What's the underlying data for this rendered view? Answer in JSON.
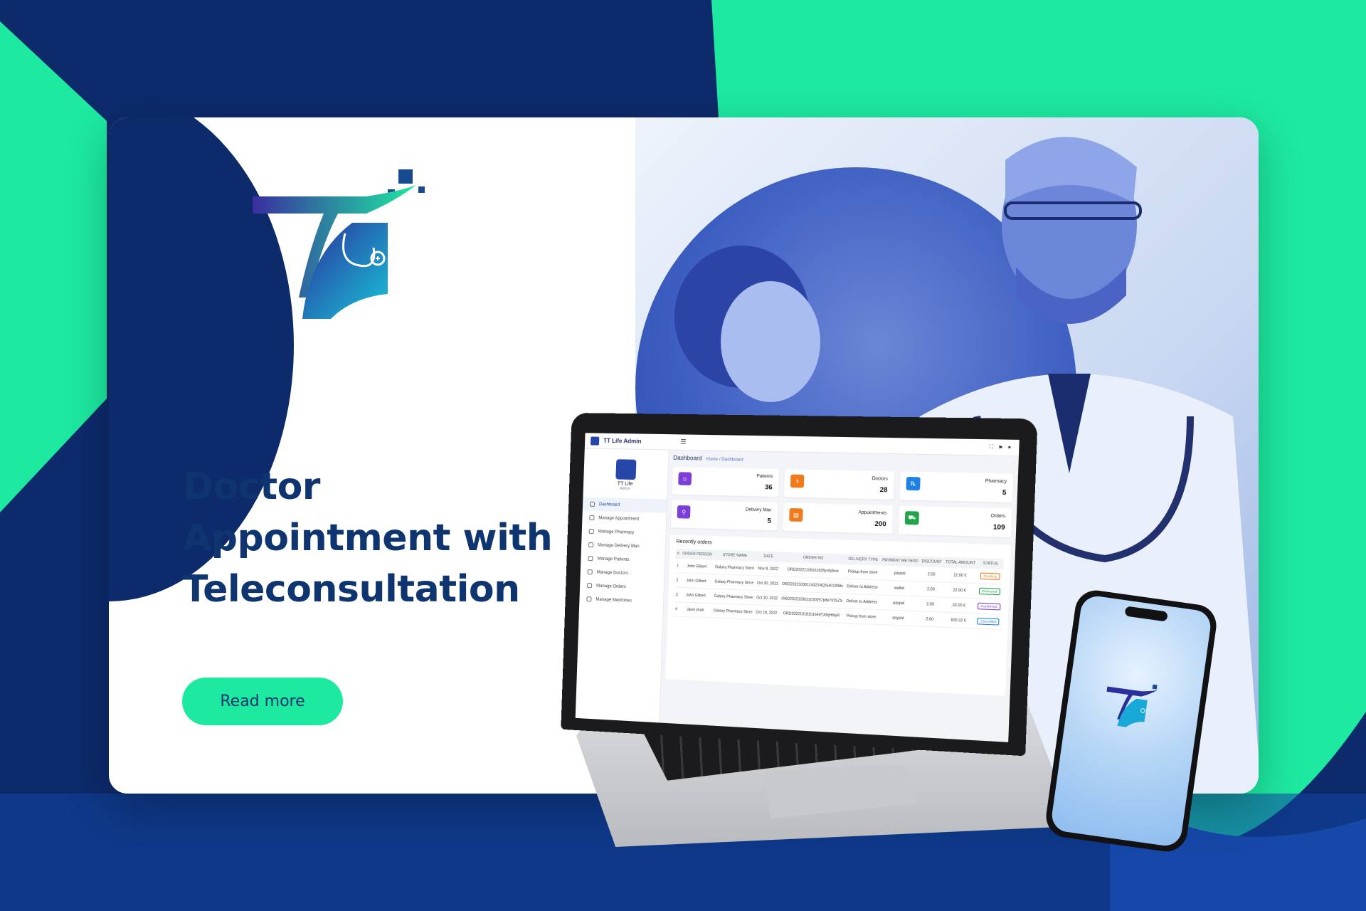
{
  "headline": {
    "line1": "Doctor",
    "line2": "Appointment with",
    "line3": "Teleconsultation"
  },
  "cta": {
    "label": "Read more"
  },
  "colors": {
    "navy": "#0d2a6b",
    "mint": "#1de9a0",
    "text": "#0f3570"
  },
  "admin": {
    "app_title": "TT Life Admin",
    "sidebar": {
      "profile_name": "TT Life",
      "profile_role": "Admin",
      "items": [
        "Dashboard",
        "Manage Appointment",
        "Manage Pharmacy",
        "Manage Delivery Man",
        "Manage Patients",
        "Manage Doctors",
        "Manage Orders",
        "Manage Medicines"
      ]
    },
    "page_title": "Dashboard",
    "breadcrumb": "Home / Dashboard",
    "stats": [
      {
        "label": "Patients",
        "value": "36",
        "color": "#7b3fd6"
      },
      {
        "label": "Doctors",
        "value": "28",
        "color": "#f07b1d"
      },
      {
        "label": "Pharmacy",
        "value": "5",
        "color": "#1f7fe8"
      },
      {
        "label": "Delivery Man",
        "value": "5",
        "color": "#7b3fd6"
      },
      {
        "label": "Appointments",
        "value": "200",
        "color": "#f07b1d"
      },
      {
        "label": "Orders",
        "value": "109",
        "color": "#21a34a"
      }
    ],
    "orders_title": "Recently orders",
    "order_headers": [
      "#",
      "ORDER PERSON",
      "STORE NAME",
      "DATE",
      "ORDER NO",
      "DELIVERY TYPE",
      "PAYMENT METHOD",
      "DISCOUNT",
      "TOTAL AMOUNT",
      "STATUS"
    ],
    "orders": [
      {
        "n": "1",
        "person": "John Gilbert",
        "store": "Galaxy Pharmacy Store",
        "date": "Nov 8, 2022",
        "no": "ORD2022110916182fiyvfq9sst",
        "type": "Pickup from store",
        "pay": "paypal",
        "disc": "2.00",
        "total": "12.00 €",
        "status": "Pending",
        "sc": "#f07b1d"
      },
      {
        "n": "2",
        "person": "John Gilbert",
        "store": "Galaxy Pharmacy Store",
        "date": "Oct 30, 2022",
        "no": "ORD20221030114321NQSuK1Wfdo",
        "type": "Deliver to Address",
        "pay": "wallet",
        "disc": "2.00",
        "total": "22.00 €",
        "status": "Delivered",
        "sc": "#21a34a"
      },
      {
        "n": "3",
        "person": "John Gilbert",
        "store": "Galaxy Pharmacy Store",
        "date": "Oct 30, 2022",
        "no": "ORD2022103011030257p8e7t/25ZS",
        "type": "Deliver to Address",
        "pay": "paypal",
        "disc": "2.00",
        "total": "32.00 €",
        "status": "Confirmed",
        "sc": "#7b3fd6"
      },
      {
        "n": "4",
        "person": "Jainil shah",
        "store": "Galaxy Pharmacy Store",
        "date": "Oct 18, 2022",
        "no": "ORD20221018101649TXRjH6fyR",
        "type": "Pickup from store",
        "pay": "paypal",
        "disc": "2.00",
        "total": "600.32 €",
        "status": "Cancelled",
        "sc": "#1f7fe8"
      }
    ]
  }
}
